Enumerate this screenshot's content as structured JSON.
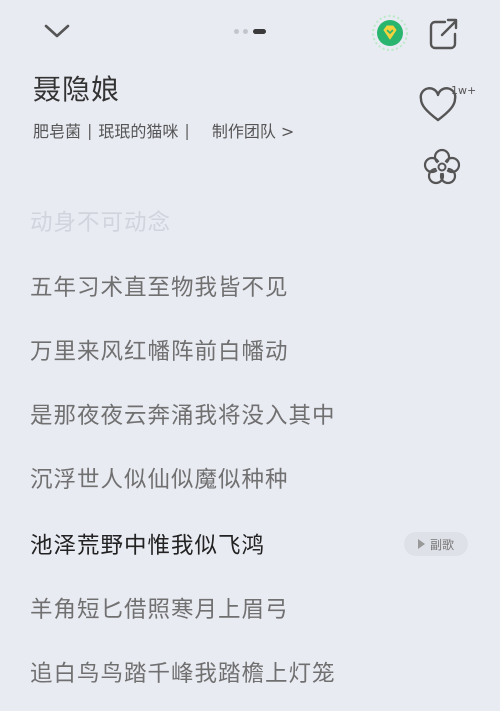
{
  "header": {
    "collapse_icon": "chevron-down-icon",
    "page_dots": 3,
    "active_dot": 3,
    "vip_badge_icon": "green-diamond-icon",
    "share_icon": "share-icon"
  },
  "song": {
    "title": "聂隐娘",
    "artist_1": "肥皂菌",
    "separator": "|",
    "artist_2": "珉珉的猫咪",
    "separator_2": "|",
    "team_label": "制作团队 >"
  },
  "actions": {
    "like_icon": "heart-icon",
    "like_count": "1w+",
    "flower_icon": "flower-icon"
  },
  "lyrics": {
    "lines": [
      "动身不可动念",
      "五年习术直至物我皆不见",
      "万里来风红幡阵前白幡动",
      "是那夜夜云奔涌我将没入其中",
      "沉浮世人似仙似魔似种种",
      "池泽荒野中惟我似飞鸿",
      "羊角短匕借照寒月上眉弓",
      "追白鸟鸟踏千峰我踏檐上灯笼"
    ],
    "current_index": 5,
    "chorus_tag": "副歌"
  },
  "colors": {
    "background": "#e9ebf3",
    "text_primary": "#222222",
    "text_secondary": "#707070",
    "vip_green": "#2ab56f"
  }
}
